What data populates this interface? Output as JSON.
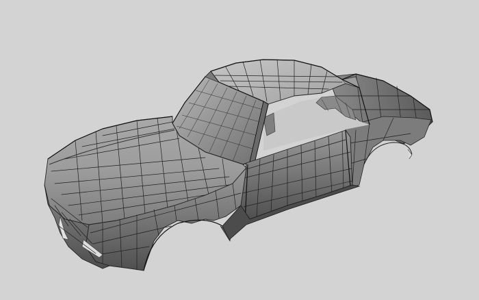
{
  "viewport": {
    "background_color": "#d3d3d3",
    "subject": "car-body-wireframe-mesh",
    "shading": "flat-gray-with-mesh-edges"
  },
  "colors": {
    "body_light": "#b4b4b4",
    "body_mid": "#8f8f8f",
    "body_dark": "#5e5e5e",
    "glass": "#9a9a9a",
    "mesh_line": "#1e1e1e"
  }
}
